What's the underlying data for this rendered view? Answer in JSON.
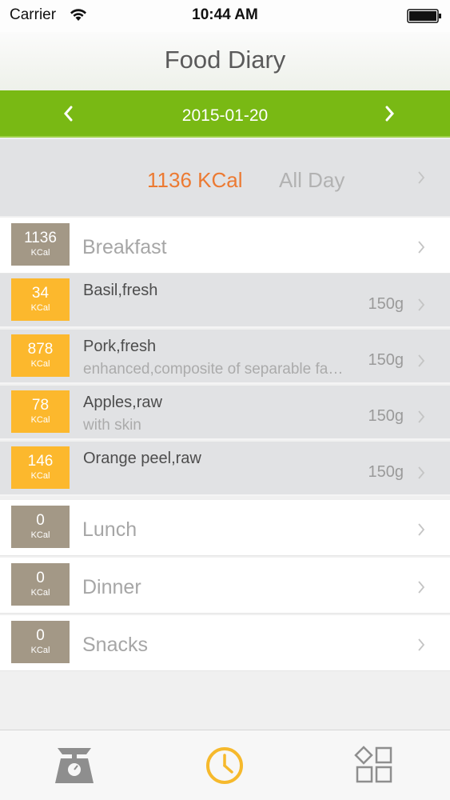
{
  "status_bar": {
    "carrier": "Carrier",
    "time": "10:44 AM"
  },
  "nav": {
    "title": "Food Diary"
  },
  "date_bar": {
    "date": "2015-01-20"
  },
  "summary": {
    "kcal": "1136 KCal",
    "label": "All Day"
  },
  "unit": "KCal",
  "meals": {
    "breakfast": {
      "name": "Breakfast",
      "kcal": "1136",
      "foods": [
        {
          "name": "Basil,fresh",
          "description": "",
          "kcal": "34",
          "weight": "150g"
        },
        {
          "name": "Pork,fresh",
          "description": "enhanced,composite of separable fat,with added solution,raw",
          "kcal": "878",
          "weight": "150g"
        },
        {
          "name": "Apples,raw",
          "description": "with skin",
          "kcal": "78",
          "weight": "150g"
        },
        {
          "name": "Orange peel,raw",
          "description": "",
          "kcal": "146",
          "weight": "150g"
        }
      ]
    },
    "lunch": {
      "name": "Lunch",
      "kcal": "0"
    },
    "dinner": {
      "name": "Dinner",
      "kcal": "0"
    },
    "snacks": {
      "name": "Snacks",
      "kcal": "0"
    }
  },
  "colors": {
    "accent_green": "#79b914",
    "kcal_orange": "#ec7a32",
    "meal_box": "#a39886",
    "food_box": "#fcb82d",
    "tab_active": "#f6b92c"
  },
  "tabs": [
    {
      "icon": "kitchen-scale-icon",
      "active": false
    },
    {
      "icon": "clock-icon",
      "active": true
    },
    {
      "icon": "grid-shapes-icon",
      "active": false
    }
  ]
}
